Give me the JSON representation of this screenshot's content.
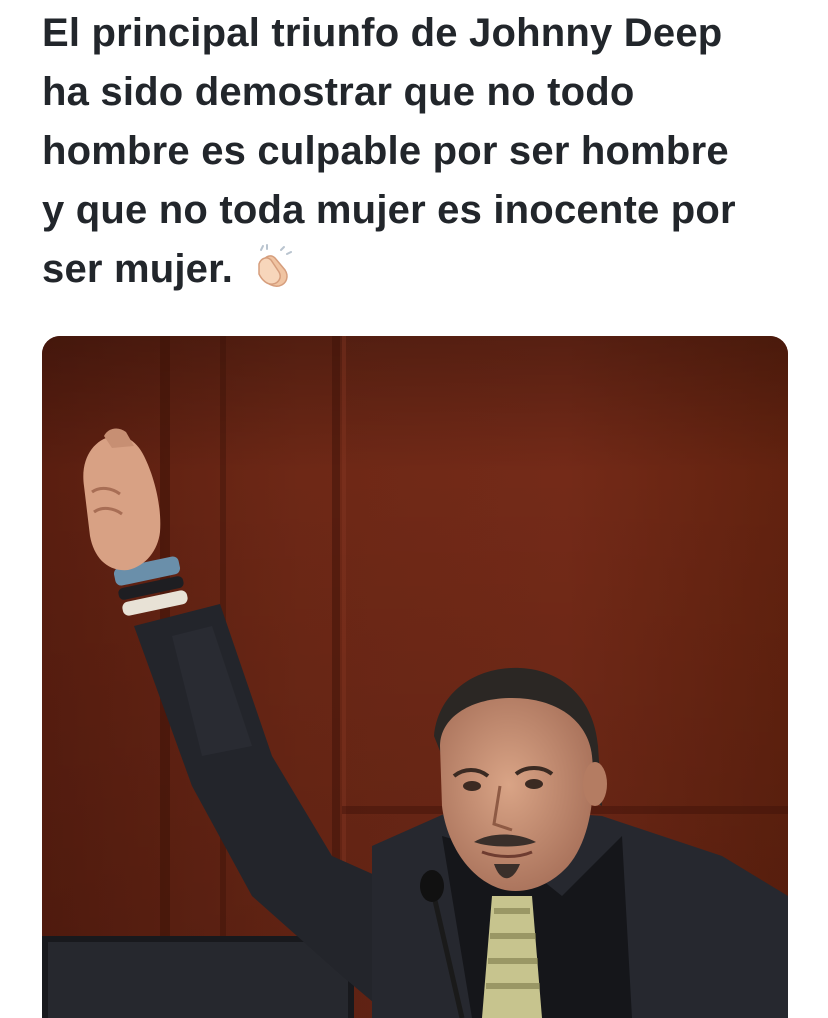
{
  "post": {
    "text_lines": [
      "El principal triunfo de Johnny Deep",
      "ha sido demostrar que no todo",
      "hombre es culpable por ser hombre",
      "y que no toda mujer es inocente por",
      "ser mujer."
    ],
    "emoji": "clapping-hands-icon"
  },
  "media": {
    "kind": "photo"
  },
  "colors": {
    "text": "#22262b",
    "background": "#ffffff",
    "wood_panel": "#6a2616",
    "suit": "#23252b"
  }
}
